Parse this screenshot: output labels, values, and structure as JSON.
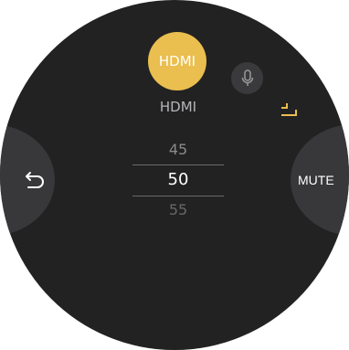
{
  "source": {
    "button_label": "HDMI",
    "current_label": "HDMI"
  },
  "picker": {
    "previous": "45",
    "current": "50",
    "next": "55"
  },
  "actions": {
    "mute_label": "MUTE",
    "back_icon": "back-arrow-icon",
    "mic_icon": "microphone-icon",
    "resize_icon": "collapse-corner-icon"
  },
  "colors": {
    "accent": "#eabe4f",
    "background": "#222223",
    "panel": "#38383a"
  }
}
